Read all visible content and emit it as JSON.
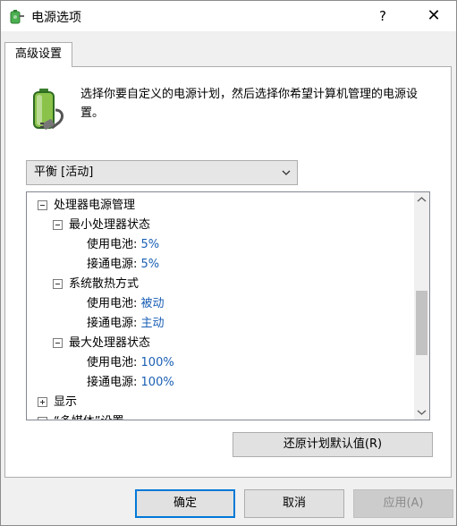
{
  "window": {
    "title": "电源选项",
    "help": "?",
    "close": "✕"
  },
  "tabs": [
    {
      "label": "高级设置"
    }
  ],
  "description": "选择你要自定义的电源计划，然后选择你希望计算机管理的电源设置。",
  "plan_select": {
    "value": "平衡 [活动]"
  },
  "tree": {
    "processor": {
      "label": "处理器电源管理",
      "min_state": {
        "label": "最小处理器状态",
        "battery_label": "使用电池:",
        "battery_value": "5%",
        "ac_label": "接通电源:",
        "ac_value": "5%"
      },
      "cooling": {
        "label": "系统散热方式",
        "battery_label": "使用电池:",
        "battery_value": "被动",
        "ac_label": "接通电源:",
        "ac_value": "主动"
      },
      "max_state": {
        "label": "最大处理器状态",
        "battery_label": "使用电池:",
        "battery_value": "100%",
        "ac_label": "接通电源:",
        "ac_value": "100%"
      }
    },
    "display": {
      "label": "显示"
    },
    "multimedia": {
      "label": "“多媒体”设置"
    }
  },
  "buttons": {
    "restore": "还原计划默认值(R)",
    "ok": "确定",
    "cancel": "取消",
    "apply": "应用(A)"
  },
  "colors": {
    "value_link": "#1a5fb4",
    "focus_border": "#0078d7"
  }
}
